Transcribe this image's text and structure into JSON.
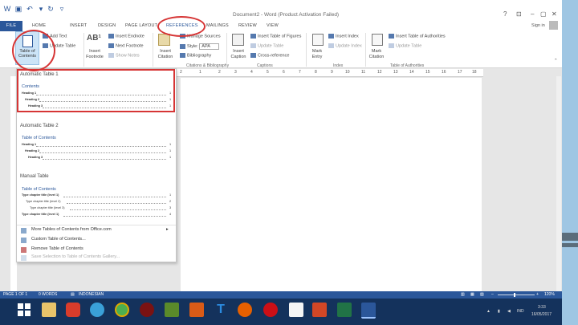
{
  "window": {
    "title": "Document2 - Word (Product Activation Failed)",
    "help": "?",
    "signin": "Sign in"
  },
  "tabs": [
    "FILE",
    "HOME",
    "INSERT",
    "DESIGN",
    "PAGE LAYOUT",
    "REFERENCES",
    "MAILINGS",
    "REVIEW",
    "VIEW"
  ],
  "active_tab": "REFERENCES",
  "ribbon": {
    "toc_button": "Table of Contents",
    "add_text": "Add Text",
    "update_table": "Update Table",
    "insert_footnote": "Insert Footnote",
    "insert_endnote": "Insert Endnote",
    "next_footnote": "Next Footnote",
    "show_notes": "Show Notes",
    "insert_citation": "Insert Citation",
    "manage_sources": "Manage Sources",
    "style_label": "Style:",
    "style_value": "APA",
    "bibliography": "Bibliography",
    "insert_caption": "Insert Caption",
    "insert_table_figures": "Insert Table of Figures",
    "update_table2": "Update Table",
    "cross_reference": "Cross-reference",
    "mark_entry": "Mark Entry",
    "insert_index": "Insert Index",
    "update_index": "Update Index",
    "mark_citation": "Mark Citation",
    "insert_toa": "Insert Table of Authorities",
    "update_table3": "Update Table",
    "groups": [
      "Citations & Bibliography",
      "Captions",
      "Index",
      "Table of Authorities"
    ]
  },
  "ruler_ticks": [
    "2",
    "1",
    "2",
    "3",
    "4",
    "5",
    "6",
    "7",
    "8",
    "9",
    "10",
    "11",
    "12",
    "13",
    "14",
    "15",
    "16",
    "17",
    "18"
  ],
  "dropdown": {
    "sections": [
      {
        "title": "Automatic Table 1",
        "toc_title": "Contents",
        "entries": [
          {
            "text": "Heading 1",
            "page": "1"
          },
          {
            "text": "Heading 2",
            "page": "1"
          },
          {
            "text": "Heading 3",
            "page": "1"
          }
        ]
      },
      {
        "title": "Automatic Table 2",
        "toc_title": "Table of Contents",
        "entries": [
          {
            "text": "Heading 1",
            "page": "1"
          },
          {
            "text": "Heading 2",
            "page": "1"
          },
          {
            "text": "Heading 3",
            "page": "1"
          }
        ]
      },
      {
        "title": "Manual Table",
        "toc_title": "Table of Contents",
        "entries": [
          {
            "text": "Type chapter title (level 1)",
            "page": "1"
          },
          {
            "text": "Type chapter title (level 2)",
            "page": "2"
          },
          {
            "text": "Type chapter title (level 3)",
            "page": "3"
          },
          {
            "text": "Type chapter title (level 1)",
            "page": "4"
          }
        ]
      }
    ],
    "menu": [
      {
        "label": "More Tables of Contents from Office.com",
        "arrow": "▸"
      },
      {
        "label": "Custom Table of Contents..."
      },
      {
        "label": "Remove Table of Contents"
      },
      {
        "label": "Save Selection to Table of Contents Gallery..."
      }
    ]
  },
  "status": {
    "page": "PAGE 1 OF 1",
    "words": "0 WORDS",
    "language": "INDONESIAN",
    "zoom": "120%"
  },
  "taskbar": {
    "time": "3:33",
    "date": "16/05/2017",
    "lang": "IND"
  },
  "colors": {
    "word_blue": "#2b579a",
    "annotation_red": "#d63535",
    "taskbar": "#14325c"
  }
}
